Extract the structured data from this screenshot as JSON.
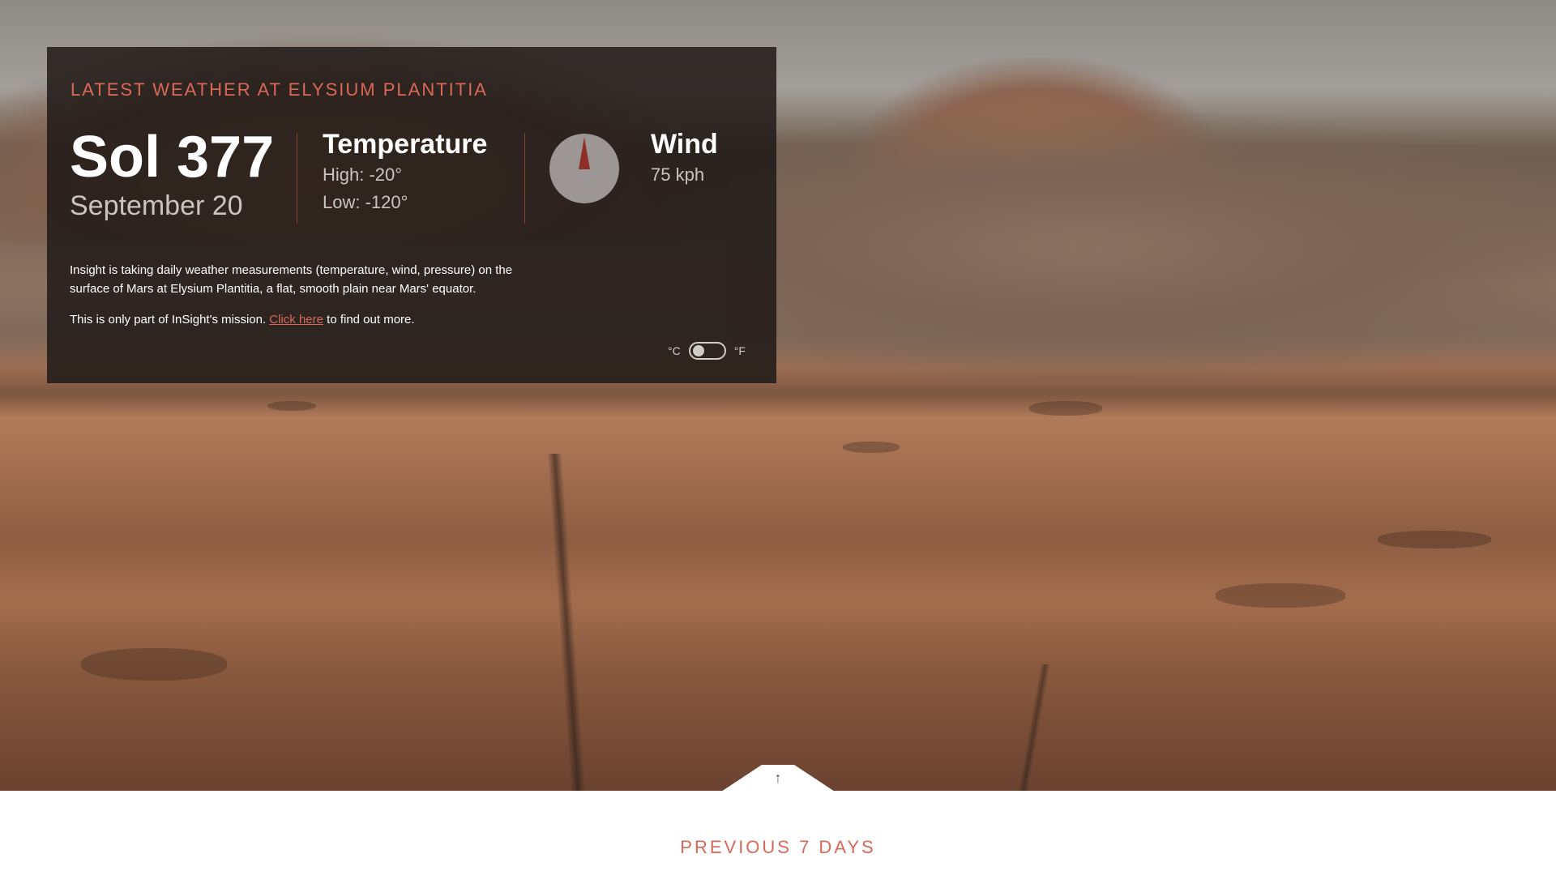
{
  "card": {
    "title": "LATEST WEATHER AT ELYSIUM PLANTITIA",
    "sol": "Sol 377",
    "date": "September 20",
    "temperature": {
      "heading": "Temperature",
      "high": "High: -20°",
      "low": "Low: -120°"
    },
    "wind": {
      "heading": "Wind",
      "speed": "75 kph",
      "compass_icon": "compass-icon"
    },
    "info": {
      "paragraph1": "Insight is taking daily weather measurements (temperature, wind, pressure) on the surface of Mars at Elysium Plantitia, a flat, smooth plain near Mars' equator.",
      "p2_before": "This is only part of InSight's mission.",
      "p2_link": "Click here",
      "p2_after": "to find out more."
    },
    "unit_toggle": {
      "celsius": "°C",
      "fahrenheit": "°F"
    }
  },
  "previous": {
    "title": "PREVIOUS 7 DAYS",
    "toggle_icon": "arrow-up-icon"
  },
  "colors": {
    "accent": "#d96859",
    "card_bg": "#1e1916",
    "compass": "#9c9794",
    "needle": "#8e2f2a"
  }
}
